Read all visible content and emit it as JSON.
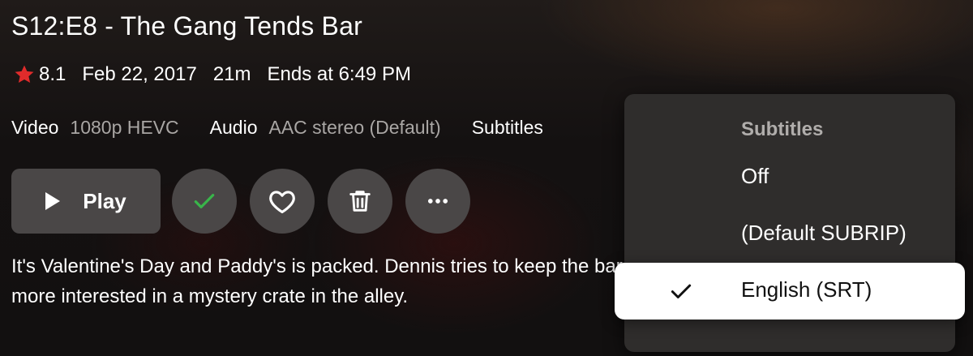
{
  "episode": {
    "title": "S12:E8 - The Gang Tends Bar",
    "rating": "8.1",
    "air_date": "Feb 22, 2017",
    "runtime": "21m",
    "ends_at": "Ends at 6:49 PM",
    "overview": "It's Valentine's Day and Paddy's is packed. Dennis tries to keep the bar running while the rest of the Gang are more interested in a mystery crate in the alley."
  },
  "streams": {
    "video_label": "Video",
    "video_value": "1080p HEVC",
    "audio_label": "Audio",
    "audio_value": "AAC stereo (Default)",
    "subtitles_label": "Subtitles"
  },
  "actions": {
    "play_label": "Play"
  },
  "subtitle_menu": {
    "title": "Subtitles",
    "options": [
      "Off",
      "(Default SUBRIP)",
      "English (SRT)"
    ],
    "selected": "English (SRT)"
  },
  "colors": {
    "star": "#e02b2b",
    "watched_check": "#39b54a",
    "button_bg": "#4a4747",
    "menu_bg": "#2f2d2c",
    "selected_bg": "#ffffff"
  },
  "icons": [
    "star-icon",
    "play-icon",
    "check-icon",
    "heart-icon",
    "trash-icon",
    "more-icon"
  ]
}
